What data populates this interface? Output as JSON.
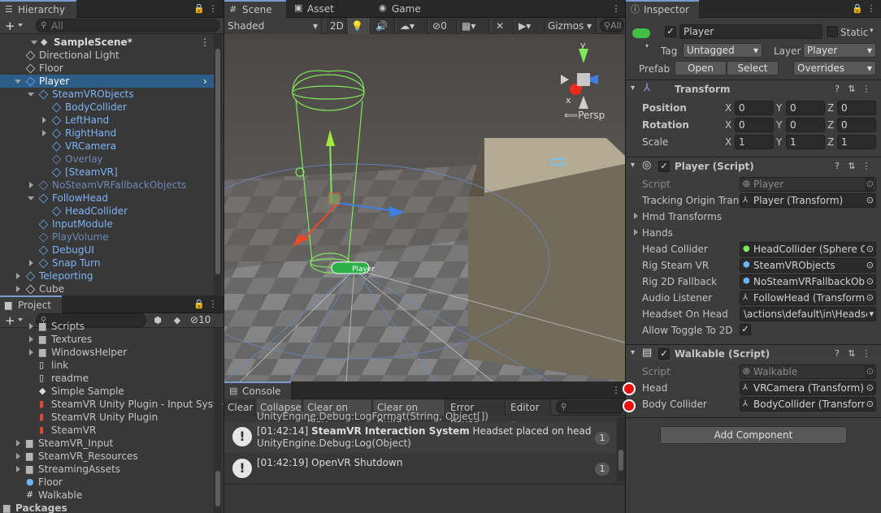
{
  "hierarchy": {
    "tab": "Hierarchy",
    "search_placeholder": "All",
    "items": [
      {
        "label": "SampleScene*",
        "indent": 0,
        "type": "scene"
      },
      {
        "label": "Directional Light",
        "indent": 1,
        "type": "plain"
      },
      {
        "label": "Floor",
        "indent": 1,
        "type": "plain"
      },
      {
        "label": "Player",
        "indent": 1,
        "type": "prefab",
        "selected": true,
        "expanded": true
      },
      {
        "label": "SteamVRObjects",
        "indent": 2,
        "type": "prefab",
        "expanded": true
      },
      {
        "label": "BodyCollider",
        "indent": 3,
        "type": "prefab"
      },
      {
        "label": "LeftHand",
        "indent": 3,
        "type": "prefab",
        "collapsed": true
      },
      {
        "label": "RightHand",
        "indent": 3,
        "type": "prefab",
        "collapsed": true
      },
      {
        "label": "VRCamera",
        "indent": 3,
        "type": "prefab"
      },
      {
        "label": "Overlay",
        "indent": 3,
        "type": "disabled"
      },
      {
        "label": "[SteamVR]",
        "indent": 3,
        "type": "prefab"
      },
      {
        "label": "NoSteamVRFallbackObjects",
        "indent": 2,
        "type": "disabled",
        "collapsed": true
      },
      {
        "label": "FollowHead",
        "indent": 2,
        "type": "prefab",
        "expanded": true
      },
      {
        "label": "HeadCollider",
        "indent": 3,
        "type": "prefab"
      },
      {
        "label": "InputModule",
        "indent": 2,
        "type": "prefab"
      },
      {
        "label": "PlayVolume",
        "indent": 2,
        "type": "disabled"
      },
      {
        "label": "DebugUI",
        "indent": 2,
        "type": "prefab"
      },
      {
        "label": "Snap Turn",
        "indent": 2,
        "type": "prefab",
        "collapsed": true
      },
      {
        "label": "Teleporting",
        "indent": 1,
        "type": "prefabroot",
        "collapsed": true
      },
      {
        "label": "Cube",
        "indent": 1,
        "type": "plain",
        "collapsed": true
      }
    ]
  },
  "project": {
    "tab": "Project",
    "hidden_count": "10",
    "items": [
      {
        "label": "Scripts",
        "indent": 1,
        "type": "folder"
      },
      {
        "label": "Textures",
        "indent": 1,
        "type": "folder"
      },
      {
        "label": "WindowsHelper",
        "indent": 1,
        "type": "folder"
      },
      {
        "label": "link",
        "indent": 1,
        "type": "file"
      },
      {
        "label": "readme",
        "indent": 1,
        "type": "file"
      },
      {
        "label": "Simple Sample",
        "indent": 1,
        "type": "unity"
      },
      {
        "label": "SteamVR Unity Plugin - Input System",
        "indent": 1,
        "type": "pdf"
      },
      {
        "label": "SteamVR Unity Plugin",
        "indent": 1,
        "type": "pdf"
      },
      {
        "label": "SteamVR",
        "indent": 1,
        "type": "pdf"
      },
      {
        "label": "SteamVR_Input",
        "indent": 0,
        "type": "folder"
      },
      {
        "label": "SteamVR_Resources",
        "indent": 0,
        "type": "folder"
      },
      {
        "label": "StreamingAssets",
        "indent": 0,
        "type": "folder"
      },
      {
        "label": "Floor",
        "indent": 0,
        "type": "material"
      },
      {
        "label": "Walkable",
        "indent": 0,
        "type": "script"
      },
      {
        "label": "Packages",
        "indent": -1,
        "type": "folderbold"
      }
    ]
  },
  "scene": {
    "tabs": [
      "Scene",
      "Asset Store",
      "Game"
    ],
    "shading": "Shaded",
    "mode2d": "2D",
    "hidden_layers": "0",
    "gizmos": "Gizmos",
    "search_placeholder": "All",
    "persp": "Persp",
    "player_label": "Player",
    "axis_y": "y",
    "axis_x": "x"
  },
  "console": {
    "tab": "Console",
    "buttons": [
      "Clear",
      "Collapse",
      "Clear on Play",
      "Clear on Build",
      "Error Pause",
      "Editor"
    ],
    "partial_line": "UnityEngine.Debug:LogFormat(String, Object[])",
    "entries": [
      {
        "time": "[01:42:14]",
        "bold": "SteamVR Interaction System",
        "rest": " Headset placed on head",
        "line2": "UnityEngine.Debug:Log(Object)",
        "count": "1"
      },
      {
        "time": "[01:42:19]",
        "bold": "",
        "rest": "OpenVR Shutdown",
        "line2": "",
        "count": "1"
      }
    ]
  },
  "inspector": {
    "tab": "Inspector",
    "object_name": "Player",
    "static_label": "Static",
    "tag_label": "Tag",
    "tag_value": "Untagged",
    "layer_label": "Layer",
    "layer_value": "Player",
    "prefab_label": "Prefab",
    "open": "Open",
    "select": "Select",
    "overrides": "Overrides",
    "transform": {
      "title": "Transform",
      "rows": [
        {
          "label": "Position",
          "x": "0",
          "y": "0",
          "z": "0"
        },
        {
          "label": "Rotation",
          "x": "0",
          "y": "0",
          "z": "0"
        },
        {
          "label": "Scale",
          "x": "1",
          "y": "1",
          "z": "1"
        }
      ]
    },
    "player_script": {
      "title": "Player (Script)",
      "rows": [
        {
          "label": "Script",
          "value": "Player",
          "icon": "script"
        },
        {
          "label": "Tracking Origin Trans",
          "value": "Player (Transform)",
          "icon": "transform"
        },
        {
          "label": "Hmd Transforms",
          "value": "",
          "foldout": true
        },
        {
          "label": "Hands",
          "value": "",
          "foldout": true
        },
        {
          "label": "Head Collider",
          "value": "HeadCollider (Sphere C",
          "icon": "collider"
        },
        {
          "label": "Rig Steam VR",
          "value": "SteamVRObjects",
          "icon": "prefab"
        },
        {
          "label": "Rig 2D Fallback",
          "value": "NoSteamVRFallbackOb",
          "icon": "prefab"
        },
        {
          "label": "Audio Listener",
          "value": "FollowHead (Transform)",
          "icon": "transform"
        },
        {
          "label": "Headset On Head",
          "value": "\\actions\\default\\in\\Headse",
          "icon": "dropdown"
        },
        {
          "label": "Allow Toggle To 2D",
          "value": "",
          "check": true
        }
      ]
    },
    "walkable_script": {
      "title": "Walkable (Script)",
      "rows": [
        {
          "label": "Script",
          "value": "Walkable",
          "icon": "script"
        },
        {
          "label": "Head",
          "value": "VRCamera (Transform)",
          "icon": "transform"
        },
        {
          "label": "Body Collider",
          "value": "BodyCollider (Transform",
          "icon": "transform"
        }
      ]
    },
    "add_component": "Add Component",
    "axis": {
      "x": "X",
      "y": "Y",
      "z": "Z"
    }
  },
  "colors": {
    "accent": "#2c5d87",
    "marker": "#e81010"
  }
}
